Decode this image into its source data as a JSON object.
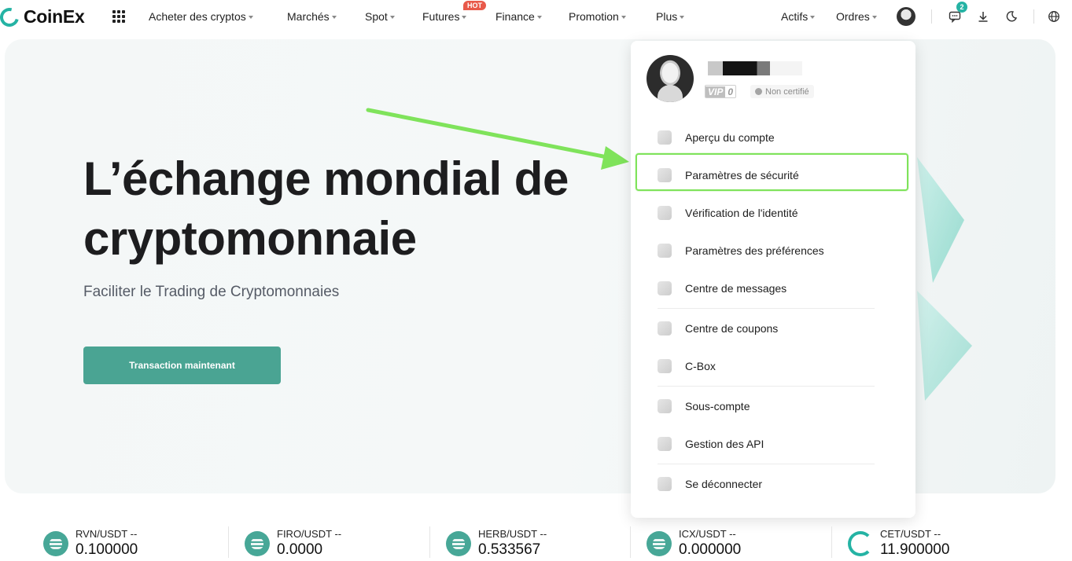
{
  "brand": {
    "name": "CoinEx",
    "color": "#25b3a4"
  },
  "nav": {
    "items": [
      {
        "label": "Acheter des cryptos"
      },
      {
        "label": "Marchés"
      },
      {
        "label": "Spot"
      },
      {
        "label": "Futures",
        "badge": "HOT"
      },
      {
        "label": "Finance"
      },
      {
        "label": "Promotion"
      },
      {
        "label": "Plus"
      }
    ],
    "right": {
      "assets": "Actifs",
      "orders": "Ordres",
      "notifications_count": "2"
    }
  },
  "hero": {
    "title_line1": "L’échange mondial de",
    "title_line2": "cryptomonnaie",
    "subtitle": "Faciliter le Trading de Cryptomonnaies",
    "cta": "Transaction maintenant"
  },
  "account_menu": {
    "vip_label": "VIP",
    "vip_level": "0",
    "certification": "Non certifié",
    "items": [
      {
        "label": "Aperçu du compte",
        "icon": "pie-chart-icon"
      },
      {
        "label": "Paramètres de sécurité",
        "icon": "shield-icon",
        "highlighted": true
      },
      {
        "label": "Vérification de l'identité",
        "icon": "id-card-icon"
      },
      {
        "label": "Paramètres des préférences",
        "icon": "preferences-icon"
      },
      {
        "label": "Centre de messages",
        "icon": "message-icon"
      },
      {
        "label": "Centre de coupons",
        "icon": "coupon-icon"
      },
      {
        "label": "C-Box",
        "icon": "box-icon"
      },
      {
        "label": "Sous-compte",
        "icon": "sub-account-icon"
      },
      {
        "label": "Gestion des API",
        "icon": "api-icon"
      },
      {
        "label": "Se déconnecter",
        "icon": "logout-icon"
      }
    ],
    "highlight_color": "#7fe35b"
  },
  "ticker": [
    {
      "pair": "RVN/USDT",
      "change": "--",
      "price": "0.100000"
    },
    {
      "pair": "FIRO/USDT",
      "change": "--",
      "price": "0.0000"
    },
    {
      "pair": "HERB/USDT",
      "change": "--",
      "price": "0.533567"
    },
    {
      "pair": "ICX/USDT",
      "change": "--",
      "price": "0.000000"
    },
    {
      "pair": "CET/USDT",
      "change": "--",
      "price": "11.900000"
    }
  ]
}
